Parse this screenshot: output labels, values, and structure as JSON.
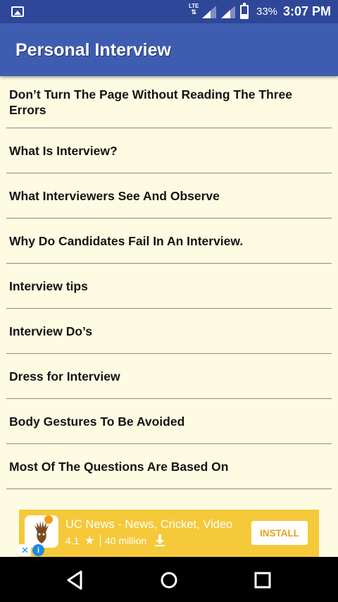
{
  "status_bar": {
    "network": "LTE",
    "battery_percent": "33%",
    "time": "3:07 PM",
    "battery_level": 0.33,
    "icons": [
      "image-icon",
      "lte-data-icon",
      "signal-icon",
      "signal-icon",
      "battery-icon"
    ]
  },
  "app_bar": {
    "title": "Personal Interview",
    "color": "#3F5DB0"
  },
  "list": {
    "items": [
      {
        "label": "Don’t Turn The Page Without Reading The Three Errors"
      },
      {
        "label": "What Is Interview?"
      },
      {
        "label": "What Interviewers See And Observe"
      },
      {
        "label": "Why Do Candidates Fail In An Interview."
      },
      {
        "label": "Interview tips"
      },
      {
        "label": "Interview Do’s"
      },
      {
        "label": "Dress for Interview"
      },
      {
        "label": "Body Gestures To Be Avoided"
      },
      {
        "label": "Most Of The Questions Are Based On"
      }
    ]
  },
  "ad": {
    "title": "UC News - News, Cricket, Video",
    "rating": "4.1",
    "downloads": "40 million",
    "install_label": "INSTALL",
    "close_glyph": "✕",
    "info_glyph": "i",
    "background": "#F5C93A"
  },
  "nav_bar": {
    "buttons": [
      "back-icon",
      "home-icon",
      "recents-icon"
    ]
  }
}
